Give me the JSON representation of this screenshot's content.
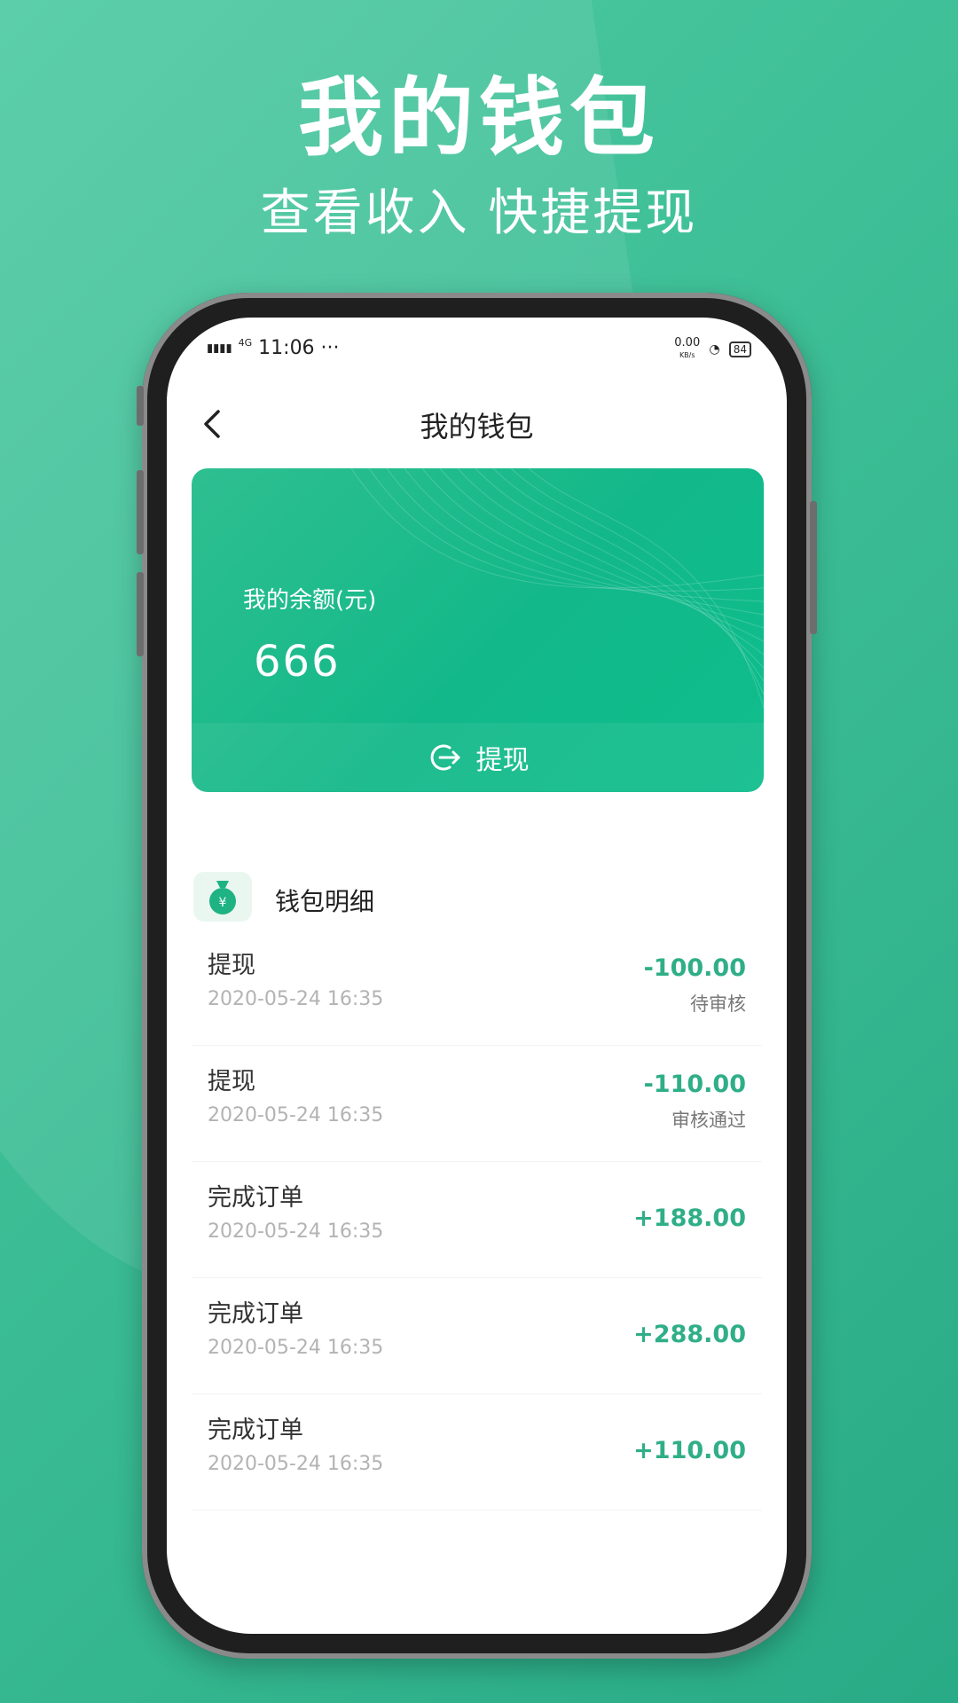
{
  "promo": {
    "title": "我的钱包",
    "subtitle": "查看收入 快捷提现"
  },
  "status_bar": {
    "time": "11:06 ···",
    "network_speed": "0.00",
    "network_speed_unit": "KB/s",
    "signal_label": "4G",
    "battery": "84"
  },
  "nav": {
    "title": "我的钱包",
    "back_icon": "chevron-left-icon"
  },
  "balance_card": {
    "label": "我的余额(元)",
    "amount": "666",
    "withdraw_label": "提现",
    "withdraw_icon": "logout-arrow-icon"
  },
  "details": {
    "title": "钱包明细",
    "icon": "money-bag-icon",
    "items": [
      {
        "name": "提现",
        "time": "2020-05-24 16:35",
        "amount": "-100.00",
        "status": "待审核"
      },
      {
        "name": "提现",
        "time": "2020-05-24 16:35",
        "amount": "-110.00",
        "status": "审核通过"
      },
      {
        "name": "完成订单",
        "time": "2020-05-24 16:35",
        "amount": "+188.00",
        "status": ""
      },
      {
        "name": "完成订单",
        "time": "2020-05-24 16:35",
        "amount": "+288.00",
        "status": ""
      },
      {
        "name": "完成订单",
        "time": "2020-05-24 16:35",
        "amount": "+110.00",
        "status": ""
      }
    ]
  },
  "colors": {
    "background": "#3ebf96",
    "accent": "#2fae87",
    "card": "#12b889"
  }
}
